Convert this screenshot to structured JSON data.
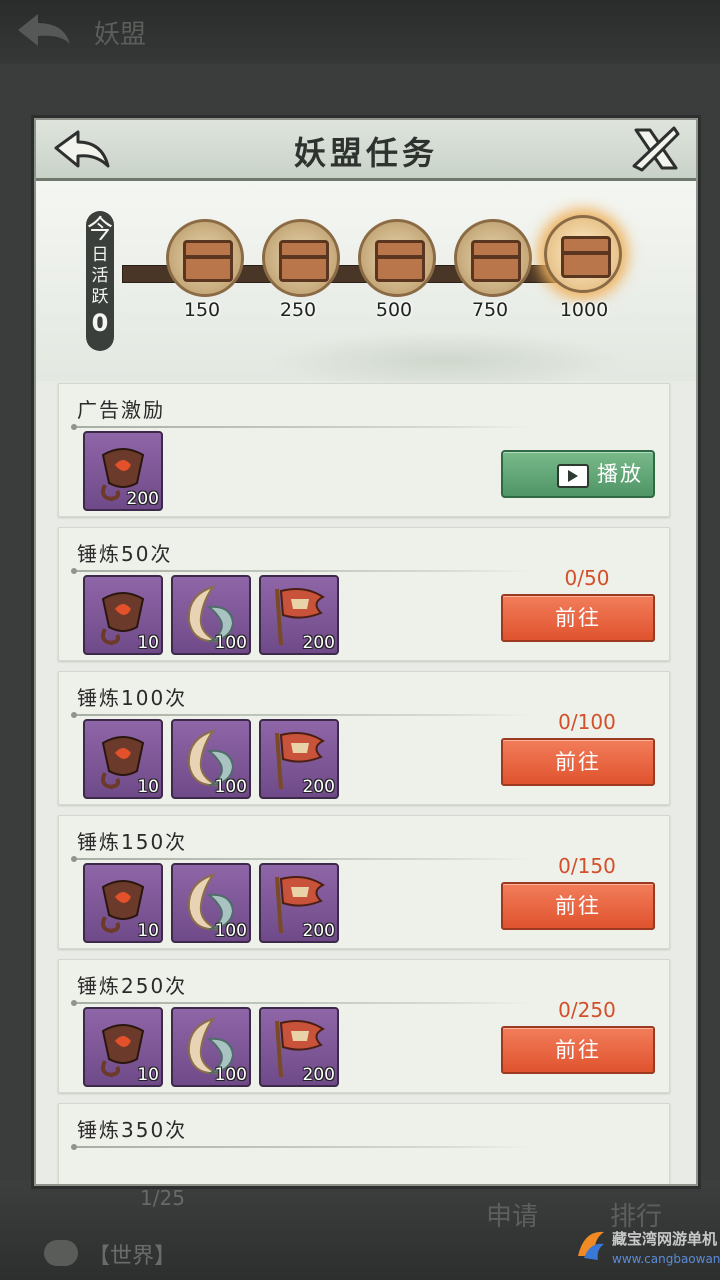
{
  "background": {
    "title": "妖盟",
    "member_count": "1/25",
    "apply_label": "申请",
    "rank_label": "排行",
    "chat_channel": "【世界】"
  },
  "panel": {
    "title": "妖盟任务",
    "back_icon": "back-arrow-icon",
    "close_icon": "close-icon"
  },
  "activity": {
    "label_1": "今",
    "label_2": "日",
    "label_3": "活",
    "label_4": "跃",
    "value": "0",
    "milestones": [
      {
        "value": "150",
        "glow": false
      },
      {
        "value": "250",
        "glow": false
      },
      {
        "value": "500",
        "glow": false
      },
      {
        "value": "750",
        "glow": false
      },
      {
        "value": "1000",
        "glow": true
      }
    ]
  },
  "tasks": [
    {
      "title": "广告激励",
      "rewards": [
        {
          "icon": "pennant-icon",
          "qty": "200"
        }
      ],
      "progress": "",
      "button": "播放",
      "button_type": "play"
    },
    {
      "title": "锤炼50次",
      "rewards": [
        {
          "icon": "pennant-icon",
          "qty": "10"
        },
        {
          "icon": "crescent-orb-icon",
          "qty": "100"
        },
        {
          "icon": "battle-flag-icon",
          "qty": "200"
        }
      ],
      "progress": "0/50",
      "button": "前往",
      "button_type": "go"
    },
    {
      "title": "锤炼100次",
      "rewards": [
        {
          "icon": "pennant-icon",
          "qty": "10"
        },
        {
          "icon": "crescent-orb-icon",
          "qty": "100"
        },
        {
          "icon": "battle-flag-icon",
          "qty": "200"
        }
      ],
      "progress": "0/100",
      "button": "前往",
      "button_type": "go"
    },
    {
      "title": "锤炼150次",
      "rewards": [
        {
          "icon": "pennant-icon",
          "qty": "10"
        },
        {
          "icon": "crescent-orb-icon",
          "qty": "100"
        },
        {
          "icon": "battle-flag-icon",
          "qty": "200"
        }
      ],
      "progress": "0/150",
      "button": "前往",
      "button_type": "go"
    },
    {
      "title": "锤炼250次",
      "rewards": [
        {
          "icon": "pennant-icon",
          "qty": "10"
        },
        {
          "icon": "crescent-orb-icon",
          "qty": "100"
        },
        {
          "icon": "battle-flag-icon",
          "qty": "200"
        }
      ],
      "progress": "0/250",
      "button": "前往",
      "button_type": "go"
    },
    {
      "title": "锤炼350次",
      "rewards": [],
      "progress": "",
      "button": "",
      "button_type": "none"
    }
  ],
  "watermark": {
    "line1": "藏宝湾网游单机",
    "line2": "www.cangbaowan.net"
  },
  "colors": {
    "accent_go": "#e0532f",
    "accent_play": "#4f9566",
    "progress_text": "#d2502a",
    "reward_bg": "#7a549a"
  }
}
